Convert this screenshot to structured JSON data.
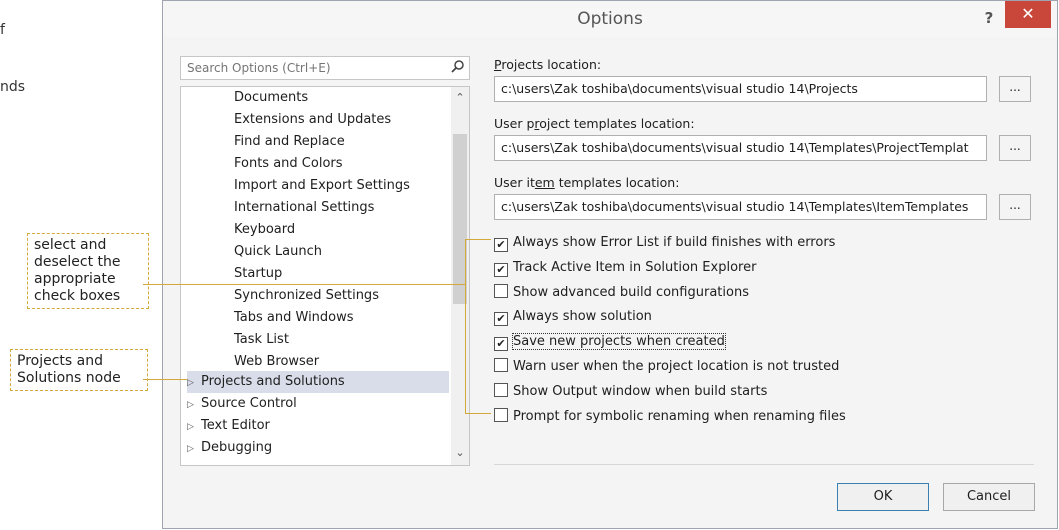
{
  "background_text": [
    "f",
    "nds"
  ],
  "callouts": {
    "checkboxes": "select and deselect the appropriate check boxes",
    "node": "Projects and Solutions node"
  },
  "dialog": {
    "title": "Options",
    "help": "?",
    "close": "✕",
    "search_placeholder": "Search Options (Ctrl+E)",
    "tree": {
      "children": [
        "Documents",
        "Extensions and Updates",
        "Find and Replace",
        "Fonts and Colors",
        "Import and Export Settings",
        "International Settings",
        "Keyboard",
        "Quick Launch",
        "Startup",
        "Synchronized Settings",
        "Tabs and Windows",
        "Task List",
        "Web Browser"
      ],
      "nodes": [
        "Projects and Solutions",
        "Source Control",
        "Text Editor",
        "Debugging"
      ],
      "selected": "Projects and Solutions"
    },
    "fields": [
      {
        "label": "Projects location:",
        "access_key": "P",
        "value": "c:\\users\\Zak toshiba\\documents\\visual studio 14\\Projects"
      },
      {
        "label": "User project templates location:",
        "access_key": "r",
        "value": "c:\\users\\Zak toshiba\\documents\\visual studio 14\\Templates\\ProjectTemplat"
      },
      {
        "label": "User item templates location:",
        "access_key": "em",
        "value": "c:\\users\\Zak toshiba\\documents\\visual studio 14\\Templates\\ItemTemplates"
      }
    ],
    "browse_label": "...",
    "options": [
      {
        "label": "Always show Error List if build finishes with errors",
        "checked": true
      },
      {
        "label": "Track Active Item in Solution Explorer",
        "checked": true
      },
      {
        "label": "Show advanced build configurations",
        "checked": false
      },
      {
        "label": "Always show solution",
        "checked": true
      },
      {
        "label": "Save new projects when created",
        "checked": true
      },
      {
        "label": "Warn user when the project location is not trusted",
        "checked": false
      },
      {
        "label": "Show Output window when build starts",
        "checked": false
      },
      {
        "label": "Prompt for symbolic renaming when renaming files",
        "checked": false
      }
    ],
    "ok": "OK",
    "cancel": "Cancel"
  }
}
